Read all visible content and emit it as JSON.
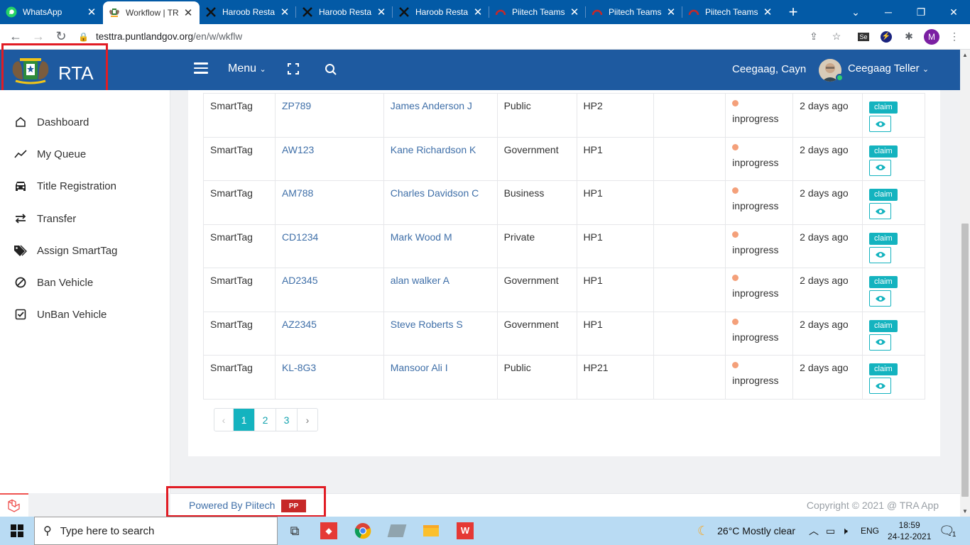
{
  "browser": {
    "tabs": [
      {
        "title": "WhatsApp",
        "icon": "whatsapp-icon",
        "active": false
      },
      {
        "title": "Workflow | TR",
        "icon": "emblem-icon",
        "active": true
      },
      {
        "title": "Haroob Resta",
        "icon": "x-logo-icon",
        "active": false
      },
      {
        "title": "Haroob Resta",
        "icon": "x-logo-icon",
        "active": false
      },
      {
        "title": "Haroob Resta",
        "icon": "x-logo-icon",
        "active": false
      },
      {
        "title": "Piitech Teams",
        "icon": "piitech-icon",
        "active": false
      },
      {
        "title": "Piitech Teams",
        "icon": "piitech-icon",
        "active": false
      },
      {
        "title": "Piitech Teams",
        "icon": "piitech-icon",
        "active": false
      }
    ],
    "url_domain": "testtra.puntlandgov.org",
    "url_path": "/en/w/wkflw",
    "profile_initial": "M"
  },
  "header": {
    "brand": "RTA",
    "menu_label": "Menu",
    "location": "Ceegaag, Cayn",
    "username": "Ceegaag Teller"
  },
  "sidebar": {
    "items": [
      {
        "label": "Dashboard",
        "icon": "home-icon"
      },
      {
        "label": "My Queue",
        "icon": "trend-icon"
      },
      {
        "label": "Title Registration",
        "icon": "car-icon"
      },
      {
        "label": "Transfer",
        "icon": "transfer-icon"
      },
      {
        "label": "Assign SmartTag",
        "icon": "tags-icon"
      },
      {
        "label": "Ban Vehicle",
        "icon": "ban-icon"
      },
      {
        "label": "UnBan Vehicle",
        "icon": "check-square-icon"
      }
    ]
  },
  "table": {
    "rows": [
      {
        "type": "SmartTag",
        "plate": "ZP789",
        "owner": "James Anderson J",
        "category": "Public",
        "code": "HP2",
        "extra": "",
        "status": "inprogress",
        "time": "2 days ago"
      },
      {
        "type": "SmartTag",
        "plate": "AW123",
        "owner": "Kane Richardson K",
        "category": "Government",
        "code": "HP1",
        "extra": "",
        "status": "inprogress",
        "time": "2 days ago"
      },
      {
        "type": "SmartTag",
        "plate": "AM788",
        "owner": "Charles Davidson C",
        "category": "Business",
        "code": "HP1",
        "extra": "",
        "status": "inprogress",
        "time": "2 days ago"
      },
      {
        "type": "SmartTag",
        "plate": "CD1234",
        "owner": "Mark Wood M",
        "category": "Private",
        "code": "HP1",
        "extra": "",
        "status": "inprogress",
        "time": "2 days ago"
      },
      {
        "type": "SmartTag",
        "plate": "AD2345",
        "owner": "alan walker A",
        "category": "Government",
        "code": "HP1",
        "extra": "",
        "status": "inprogress",
        "time": "2 days ago"
      },
      {
        "type": "SmartTag",
        "plate": "AZ2345",
        "owner": "Steve Roberts S",
        "category": "Government",
        "code": "HP1",
        "extra": "",
        "status": "inprogress",
        "time": "2 days ago"
      },
      {
        "type": "SmartTag",
        "plate": "KL-8G3",
        "owner": "Mansoor Ali I",
        "category": "Public",
        "code": "HP21",
        "extra": "",
        "status": "inprogress",
        "time": "2 days ago"
      }
    ],
    "claim_label": "claim"
  },
  "pagination": {
    "prev": "‹",
    "pages": [
      "1",
      "2",
      "3"
    ],
    "current": "1",
    "next": "›"
  },
  "footer": {
    "powered_by": "Powered By Piitech",
    "copyright": "Copyright © 2021 @ TRA App"
  },
  "taskbar": {
    "search_placeholder": "Type here to search",
    "weather": "26°C  Mostly clear",
    "language": "ENG",
    "time": "18:59",
    "date": "24-12-2021",
    "notifications": "1"
  },
  "colors": {
    "header_bg": "#1e5aa0",
    "accent": "#14b3bf",
    "status_dot": "#f4a07a",
    "highlight_box": "#e11c24"
  }
}
